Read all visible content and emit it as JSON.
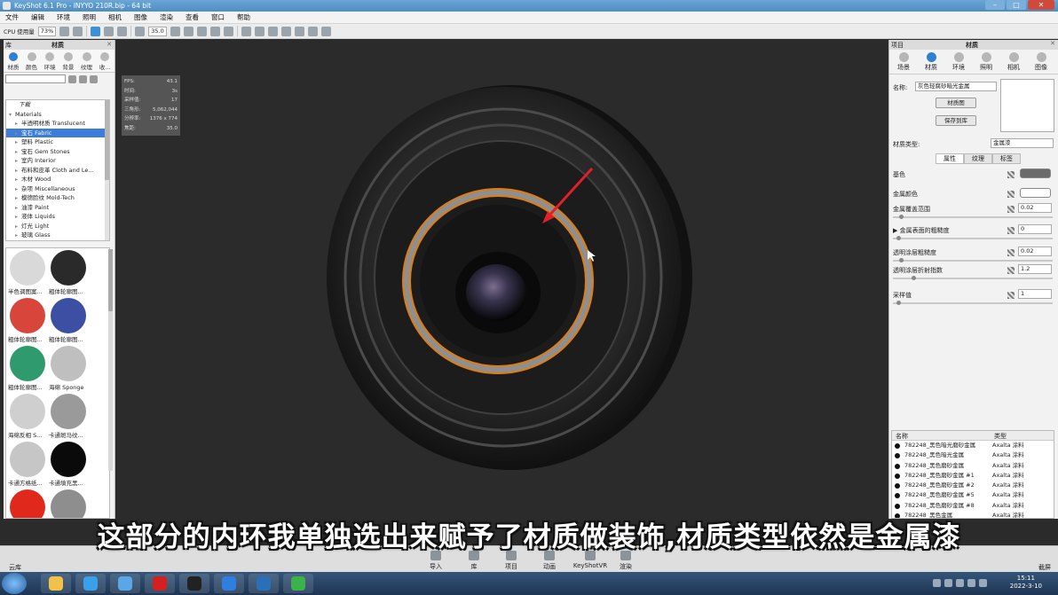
{
  "window": {
    "title": "KeyShot 6.1 Pro  -  INYYO 210R.bip  -  64 bit",
    "controls": [
      "–",
      "□",
      "✕"
    ]
  },
  "menu": [
    "文件",
    "编辑",
    "环境",
    "照明",
    "相机",
    "图像",
    "渲染",
    "查看",
    "窗口",
    "帮助"
  ],
  "toolbar": {
    "cpu_label": "CPU 使用量",
    "cpu_value": "73%",
    "focal_value": "35.0"
  },
  "library": {
    "title_left": "库",
    "title": "材质",
    "tabs": [
      "材质",
      "颜色",
      "环境",
      "背景",
      "纹理",
      "收..."
    ],
    "search_placeholder": "",
    "tree_header": "下载",
    "tree_items": [
      {
        "label": "Materials",
        "indent": 0,
        "selected": false
      },
      {
        "label": "半透明材质 Translucent",
        "indent": 1,
        "selected": false
      },
      {
        "label": "宝石 Fabric",
        "indent": 1,
        "selected": true
      },
      {
        "label": "塑料 Plastic",
        "indent": 1,
        "selected": false
      },
      {
        "label": "宝石 Gem Stones",
        "indent": 1,
        "selected": false
      },
      {
        "label": "室内 Interior",
        "indent": 1,
        "selected": false
      },
      {
        "label": "布料和皮革 Cloth and Le...",
        "indent": 1,
        "selected": false
      },
      {
        "label": "木材 Wood",
        "indent": 1,
        "selected": false
      },
      {
        "label": "杂项 Miscellaneous",
        "indent": 1,
        "selected": false
      },
      {
        "label": "模德脸纹 Mold-Tech",
        "indent": 1,
        "selected": false
      },
      {
        "label": "油漆 Paint",
        "indent": 1,
        "selected": false
      },
      {
        "label": "液体 Liquids",
        "indent": 1,
        "selected": false
      },
      {
        "label": "灯光 Light",
        "indent": 1,
        "selected": false
      },
      {
        "label": "玻璃 Glass",
        "indent": 1,
        "selected": false
      }
    ],
    "thumbnails": [
      {
        "caption": "半色调图案...",
        "color": "#d9d9d9"
      },
      {
        "caption": "粗体轮廓图...",
        "color": "#2a2a2a"
      },
      {
        "caption": "粗体轮廓图...",
        "color": "#d8453b"
      },
      {
        "caption": "粗体轮廓图...",
        "color": "#3d4fa3"
      },
      {
        "caption": "粗体轮廓图...",
        "color": "#2f9a6d"
      },
      {
        "caption": "海绵 Sponge",
        "color": "#bfbfbf"
      },
      {
        "caption": "海绵反相 S...",
        "color": "#cfcfcf"
      },
      {
        "caption": "卡通斑马纹...",
        "color": "#9a9a9a"
      },
      {
        "caption": "卡通方格纸...",
        "color": "#c6c6c6"
      },
      {
        "caption": "卡通填充黑...",
        "color": "#0a0a0a"
      },
      {
        "caption": "",
        "color": "#e0291c"
      },
      {
        "caption": "",
        "color": "#8e8e8e"
      }
    ]
  },
  "stats": [
    {
      "k": "FPS:",
      "v": "43.1"
    },
    {
      "k": "时间:",
      "v": "3s"
    },
    {
      "k": "采样值:",
      "v": "17"
    },
    {
      "k": "三角形:",
      "v": "5,062,044"
    },
    {
      "k": "分辨率:",
      "v": "1376 x 774"
    },
    {
      "k": "焦距:",
      "v": "35.0"
    }
  ],
  "project": {
    "title_left": "项目",
    "title": "材质",
    "tabs": [
      "场景",
      "材质",
      "环境",
      "照明",
      "相机",
      "图像"
    ],
    "name_label": "名称:",
    "name_value": "灰色轻腐砂暗光金属",
    "material_graph_btn": "材质图",
    "save_to_lib_btn": "保存到库",
    "type_label": "材质类型:",
    "type_value": "金属漆",
    "subtabs": [
      "属性",
      "纹理",
      "标签"
    ],
    "props": [
      {
        "label": "基色",
        "kind": "color",
        "value": "",
        "swatch": "#6b6b6b"
      },
      {
        "label": "金属颜色",
        "kind": "color",
        "value": "",
        "swatch": "#ffffff"
      },
      {
        "label": "金属覆盖范围",
        "kind": "num",
        "value": "0.02",
        "level": 0.02
      },
      {
        "label": "▶ 金属表面的粗糙度",
        "kind": "num",
        "value": "0",
        "level": 0
      },
      {
        "label": "透明涂层粗糙度",
        "kind": "num",
        "value": "0.02",
        "level": 0.02
      },
      {
        "label": "透明涂层折射指数",
        "kind": "num",
        "value": "1.2",
        "level": 0.1
      },
      {
        "label": "采样值",
        "kind": "num",
        "value": "1",
        "level": 0
      }
    ],
    "table_headers": [
      "名称",
      "类型"
    ],
    "table_rows": [
      {
        "name": "782248_黑色暗光磨砂金属",
        "type": "Axalta 涂料"
      },
      {
        "name": "782248_黑色暗光金属",
        "type": "Axalta 涂料"
      },
      {
        "name": "782248_黑色磨砂金属",
        "type": "Axalta 涂料"
      },
      {
        "name": "782248_黑色磨砂金属 #1",
        "type": "Axalta 涂料"
      },
      {
        "name": "782248_黑色磨砂金属 #2",
        "type": "Axalta 涂料"
      },
      {
        "name": "782248_黑色磨砂金属 #5",
        "type": "Axalta 涂料"
      },
      {
        "name": "782248_黑色磨砂金属 #8",
        "type": "Axalta 涂料"
      },
      {
        "name": "782248_黑色金属",
        "type": "Axalta 涂料"
      }
    ]
  },
  "bottom": {
    "left": "云库",
    "items": [
      "导入",
      "库",
      "项目",
      "动画",
      "KeyShotVR",
      "渲染"
    ],
    "right": "截屏"
  },
  "subtitle": "这部分的内环我单独选出来赋予了材质做装饰,材质类型依然是金属漆",
  "taskbar": {
    "time": "15:11",
    "date": "2022-3-10",
    "apps": [
      "#f1c24a",
      "#3aa0e8",
      "#5aa6e6",
      "#d32020",
      "#222222",
      "#2f7fe0",
      "#2a6fb8",
      "#3cb34a"
    ]
  }
}
